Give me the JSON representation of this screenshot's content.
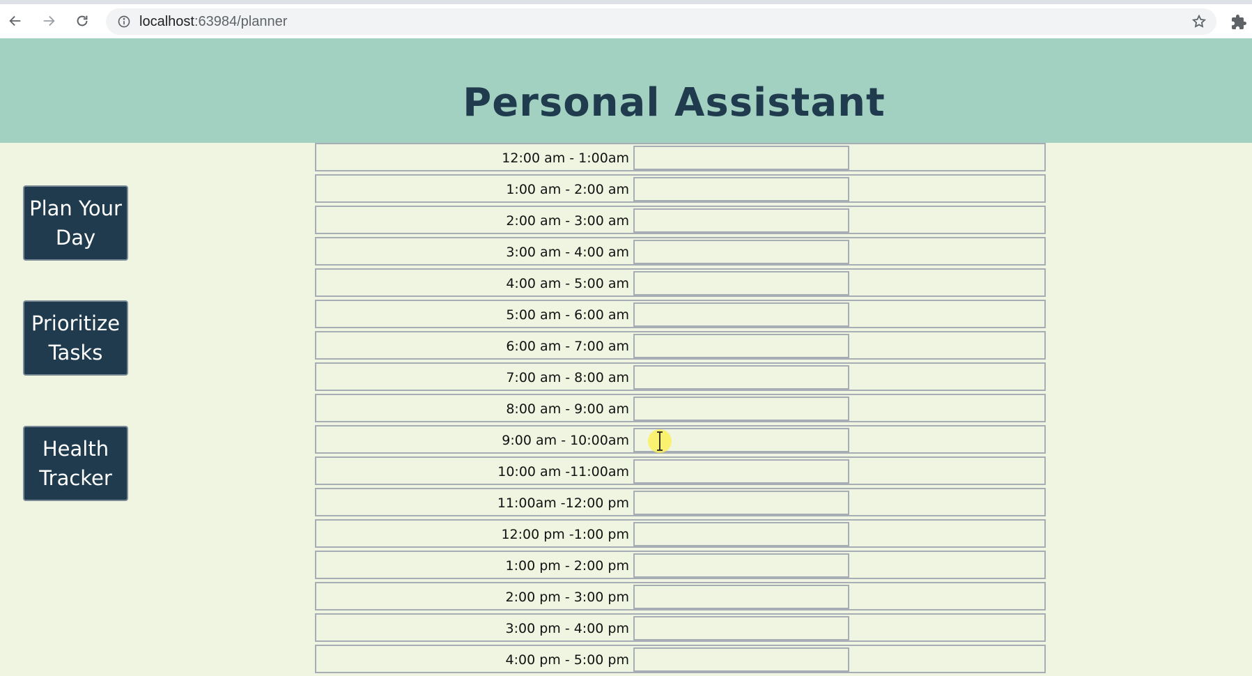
{
  "browser": {
    "url_host": "localhost",
    "url_rest": ":63984/planner"
  },
  "header": {
    "title": "Personal Assistant"
  },
  "sidebar": {
    "buttons": [
      {
        "label": "Plan Your Day"
      },
      {
        "label": "Prioritize Tasks"
      },
      {
        "label": "Health Tracker"
      }
    ]
  },
  "planner": {
    "rows": [
      {
        "time": "12:00 am - 1:00am",
        "task": ""
      },
      {
        "time": "1:00 am - 2:00 am",
        "task": ""
      },
      {
        "time": "2:00 am - 3:00 am",
        "task": ""
      },
      {
        "time": "3:00 am - 4:00 am",
        "task": ""
      },
      {
        "time": "4:00 am - 5:00 am",
        "task": ""
      },
      {
        "time": "5:00 am - 6:00 am",
        "task": ""
      },
      {
        "time": "6:00 am - 7:00 am",
        "task": ""
      },
      {
        "time": "7:00 am - 8:00 am",
        "task": ""
      },
      {
        "time": "8:00 am - 9:00 am",
        "task": ""
      },
      {
        "time": "9:00 am - 10:00am",
        "task": ""
      },
      {
        "time": "10:00 am -11:00am",
        "task": ""
      },
      {
        "time": "11:00am -12:00 pm",
        "task": ""
      },
      {
        "time": "12:00 pm -1:00 pm",
        "task": ""
      },
      {
        "time": "1:00 pm - 2:00 pm",
        "task": ""
      },
      {
        "time": "2:00 pm - 3:00 pm",
        "task": ""
      },
      {
        "time": "3:00 pm - 4:00 pm",
        "task": ""
      },
      {
        "time": "4:00 pm - 5:00 pm",
        "task": ""
      }
    ]
  },
  "colors": {
    "header_bg": "#a3d1c1",
    "page_bg": "#eff5e1",
    "button_bg": "#1f3b4d",
    "title_color": "#1f3b4d"
  },
  "icons": {
    "back": "back-arrow-icon",
    "forward": "forward-arrow-icon",
    "reload": "reload-icon",
    "info": "info-icon",
    "bookmark": "star-icon",
    "extensions": "puzzle-icon"
  }
}
